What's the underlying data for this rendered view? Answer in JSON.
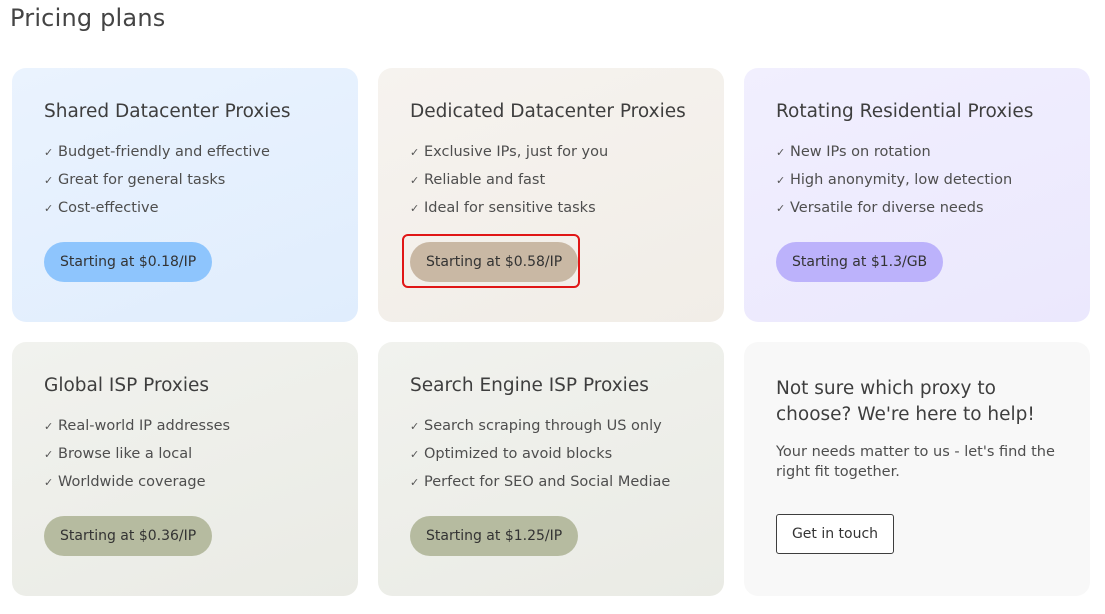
{
  "page": {
    "title": "Pricing plans"
  },
  "plans": [
    {
      "title": "Shared Datacenter Proxies",
      "features": [
        "Budget-friendly and effective",
        "Great for general tasks",
        "Cost-effective"
      ],
      "price_label": "Starting at $0.18/IP",
      "button_color": "#8ec5fd",
      "card_background": "#e3effd"
    },
    {
      "title": "Dedicated Datacenter Proxies",
      "features": [
        "Exclusive IPs, just for you",
        "Reliable and fast",
        "Ideal for sensitive tasks"
      ],
      "price_label": "Starting at $0.58/IP",
      "button_color": "#c9b8a4",
      "card_background": "#f4f1ec",
      "highlighted": true,
      "highlight_color": "#e01616"
    },
    {
      "title": "Rotating Residential Proxies",
      "features": [
        "New IPs on rotation",
        "High anonymity, low detection",
        "Versatile for diverse needs"
      ],
      "price_label": "Starting at $1.3/GB",
      "button_color": "#bcb2fb",
      "card_background": "#efedfd"
    },
    {
      "title": "Global ISP Proxies",
      "features": [
        "Real-world IP addresses",
        "Browse like a local",
        "Worldwide coverage"
      ],
      "price_label": "Starting at $0.36/IP",
      "button_color": "#b6bba0",
      "card_background": "#eeefea"
    },
    {
      "title": "Search Engine ISP Proxies",
      "features": [
        "Search scraping through US only",
        "Optimized to avoid blocks",
        "Perfect for SEO and Social Mediae"
      ],
      "price_label": "Starting at $1.25/IP",
      "button_color": "#b6bba0",
      "card_background": "#eeefea"
    }
  ],
  "help": {
    "title": "Not sure which proxy to choose? We're here to help!",
    "text": "Your needs matter to us - let's find the right fit together.",
    "button_label": "Get in touch",
    "card_background": "#f8f8f8"
  },
  "icons": {
    "check": "check-icon"
  }
}
